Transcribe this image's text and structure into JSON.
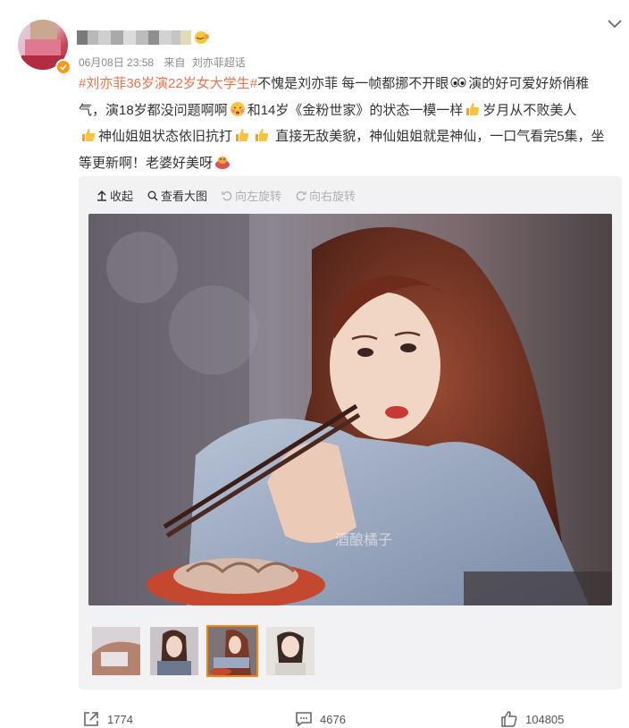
{
  "user": {
    "avatar_icon": "user-avatar",
    "verified_icon": "orange-verified-badge-icon"
  },
  "meta": {
    "time": "06月08日 23:58",
    "source_prefix": "来自",
    "source_name": "刘亦菲超话"
  },
  "post": {
    "hashtag": "#刘亦菲36岁演22岁女大学生#",
    "seg1": "不愧是刘亦菲 每一帧都挪不开眼",
    "seg2": "演的好可爱好娇俏稚气，演18岁都没问题啊啊",
    "seg3": "和14岁《金粉世家》的状态一模一样",
    "seg4": "岁月从不败美人",
    "seg5": "神仙姐姐状态依旧抗打",
    "seg6": "直接无敌美貌，神仙姐姐就是神仙，一口气看完5集，坐等更新啊！老婆好美呀"
  },
  "toolbar": {
    "collapse": "收起",
    "view_large": "查看大图",
    "rotate_left": "向左旋转",
    "rotate_right": "向右旋转"
  },
  "image": {
    "watermark": "酒酿橘子"
  },
  "thumbnails": [
    {
      "name": "thumb-1",
      "selected": false
    },
    {
      "name": "thumb-2",
      "selected": false
    },
    {
      "name": "thumb-3",
      "selected": true
    },
    {
      "name": "thumb-4",
      "selected": false
    }
  ],
  "actions": {
    "repost_count": "1774",
    "comment_count": "4676",
    "like_count": "104805"
  },
  "colors": {
    "accent": "#eb7350",
    "selected_border": "#ff8200",
    "verified": "#f79b1d"
  }
}
